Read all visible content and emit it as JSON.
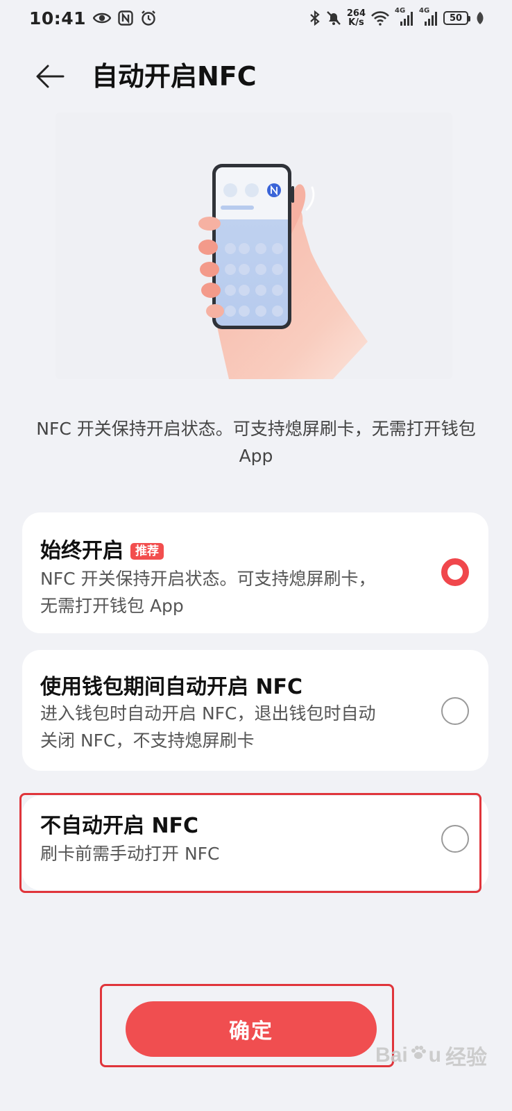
{
  "status_bar": {
    "time": "10:41",
    "net_speed_value": "264",
    "net_speed_unit": "K/s",
    "signal_1_label": "4G",
    "signal_2_label": "4G",
    "battery_level": "50",
    "icons": [
      "eye-icon",
      "nfc-status-icon",
      "alarm-icon",
      "bluetooth-icon",
      "mute-bell-icon",
      "wifi-icon",
      "signal-icon",
      "battery-icon",
      "leaf-icon"
    ]
  },
  "header": {
    "title": "自动开启NFC"
  },
  "description": "NFC 开关保持开启状态。可支持熄屏刷卡，无需打开钱包 App",
  "options": [
    {
      "title": "始终开启",
      "badge": "推荐",
      "subtitle": "NFC 开关保持开启状态。可支持熄屏刷卡，无需打开钱包 App",
      "selected": true
    },
    {
      "title": "使用钱包期间自动开启 NFC",
      "subtitle": "进入钱包时自动开启 NFC，退出钱包时自动关闭 NFC，不支持熄屏刷卡",
      "selected": false
    },
    {
      "title": "不自动开启 NFC",
      "subtitle": "刷卡前需手动打开 NFC",
      "selected": false
    }
  ],
  "confirm_label": "确定",
  "watermark": {
    "brand": "Bai",
    "brand_tail": "u",
    "cn": "经验"
  },
  "colors": {
    "accent": "#f04e50",
    "highlight_box": "#e0353b",
    "background": "#f1f2f6"
  }
}
